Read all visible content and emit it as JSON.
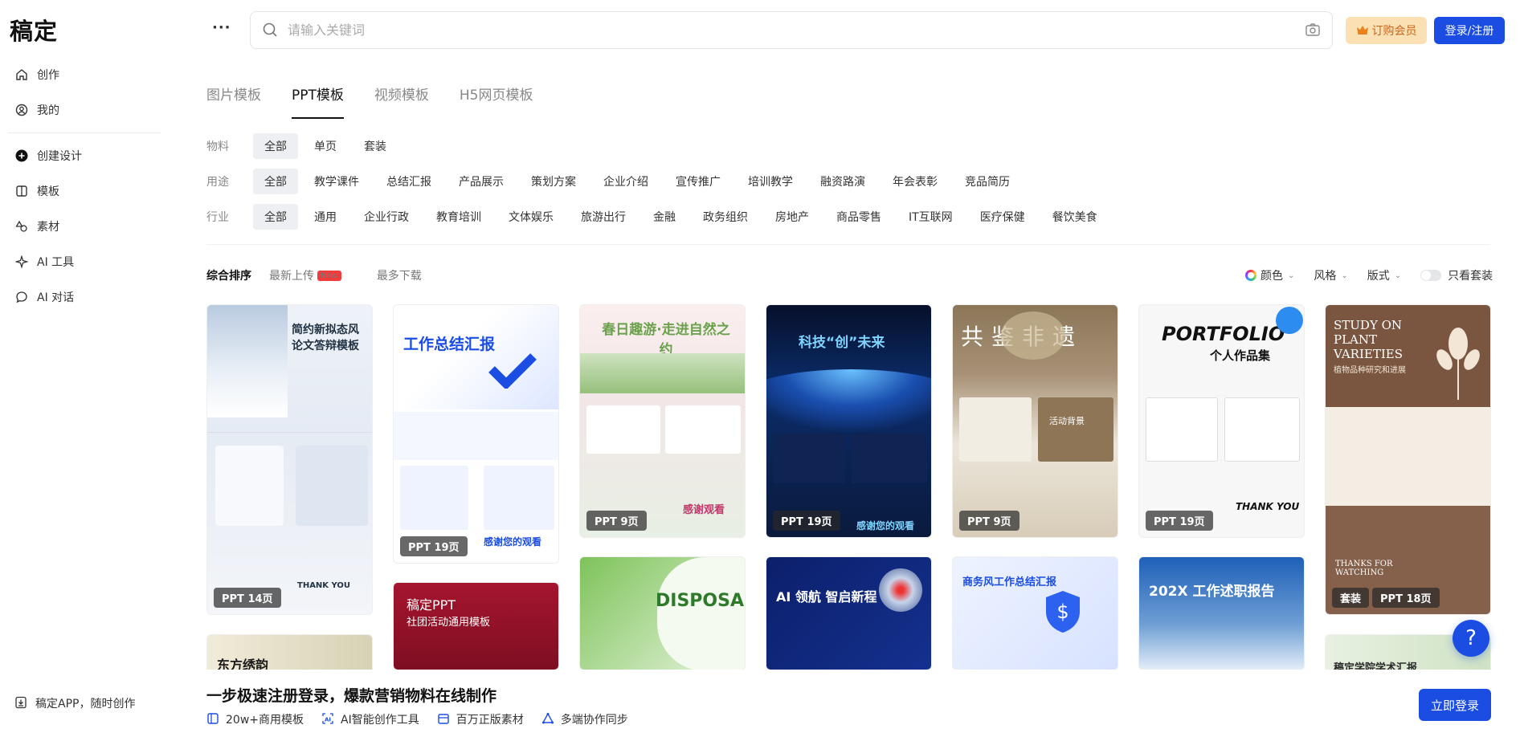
{
  "app": {
    "logo": "稿定"
  },
  "sidebar": {
    "items": [
      {
        "label": "创作",
        "icon": "home-icon"
      },
      {
        "label": "我的",
        "icon": "user-icon"
      },
      {
        "label": "创建设计",
        "icon": "plus-circle-icon"
      },
      {
        "label": "模板",
        "icon": "template-icon"
      },
      {
        "label": "素材",
        "icon": "shapes-icon"
      },
      {
        "label": "AI 工具",
        "icon": "sparkle-icon"
      },
      {
        "label": "AI 对话",
        "icon": "chat-icon"
      }
    ],
    "app_promo": "稿定APP，随时创作"
  },
  "header": {
    "more": "···",
    "search_placeholder": "请输入关键词",
    "vip_label": "订购会员",
    "login_label": "登录/注册"
  },
  "tabs": [
    {
      "label": "图片模板",
      "active": false
    },
    {
      "label": "PPT模板",
      "active": true
    },
    {
      "label": "视频模板",
      "active": false
    },
    {
      "label": "H5网页模板",
      "active": false
    }
  ],
  "filters": {
    "material": {
      "label": "物料",
      "options": [
        "全部",
        "单页",
        "套装"
      ]
    },
    "usage": {
      "label": "用途",
      "options": [
        "全部",
        "教学课件",
        "总结汇报",
        "产品展示",
        "策划方案",
        "企业介绍",
        "宣传推广",
        "培训教学",
        "融资路演",
        "年会表彰",
        "竞品简历"
      ]
    },
    "industry": {
      "label": "行业",
      "options": [
        "全部",
        "通用",
        "企业行政",
        "教育培训",
        "文体娱乐",
        "旅游出行",
        "金融",
        "政务组织",
        "房地产",
        "商品零售",
        "IT互联网",
        "医疗保健",
        "餐饮美食"
      ]
    }
  },
  "sort": {
    "options": [
      "综合排序",
      "最新上传",
      "最多下载"
    ],
    "new_badge": "New",
    "color": "颜色",
    "style": "风格",
    "layout": "版式",
    "only_sets": "只看套装"
  },
  "cards": [
    {
      "title": "简约新拟态风论文答辩模板",
      "badge": "PPT  14页",
      "extra": "THANK YOU"
    },
    {
      "title": "工作总结汇报",
      "badge": "PPT  19页",
      "extra": "感谢您的观看"
    },
    {
      "title": "春日趣游·走进自然之约",
      "badge": "PPT  9页",
      "extra": "感谢观看"
    },
    {
      "title": "科技“创”未来",
      "badge": "PPT  19页",
      "extra": "感谢您的观看"
    },
    {
      "title": "共鉴非遗",
      "badge": "PPT  9页",
      "extra": "活动背景"
    },
    {
      "title": "PORTFOLIO",
      "subtitle": "个人作品集",
      "badge": "PPT  19页",
      "extra": "THANK YOU"
    },
    {
      "title": "STUDY ON PLANT VARIETIES",
      "subtitle": "植物品种研究和进展",
      "badge_a": "套装",
      "badge": "PPT  18页",
      "extra": "THANKS FOR WATCHING"
    },
    {
      "title": "稿定PPT",
      "subtitle": "社团活动通用模板"
    },
    {
      "title": "DISPOSAL"
    },
    {
      "title": "AI 领航 智启新程"
    },
    {
      "title": "商务风工作总结汇报"
    },
    {
      "title": "202X 工作述职报告"
    },
    {
      "title": "东方绣韵"
    },
    {
      "title": "稿定学院学术汇报"
    }
  ],
  "bottom": {
    "title": "一步极速注册登录，爆款营销物料在线制作",
    "features": [
      "20w+商用模板",
      "AI智能创作工具",
      "百万正版素材",
      "多端协作同步"
    ],
    "button": "立即登录"
  },
  "help": "?"
}
